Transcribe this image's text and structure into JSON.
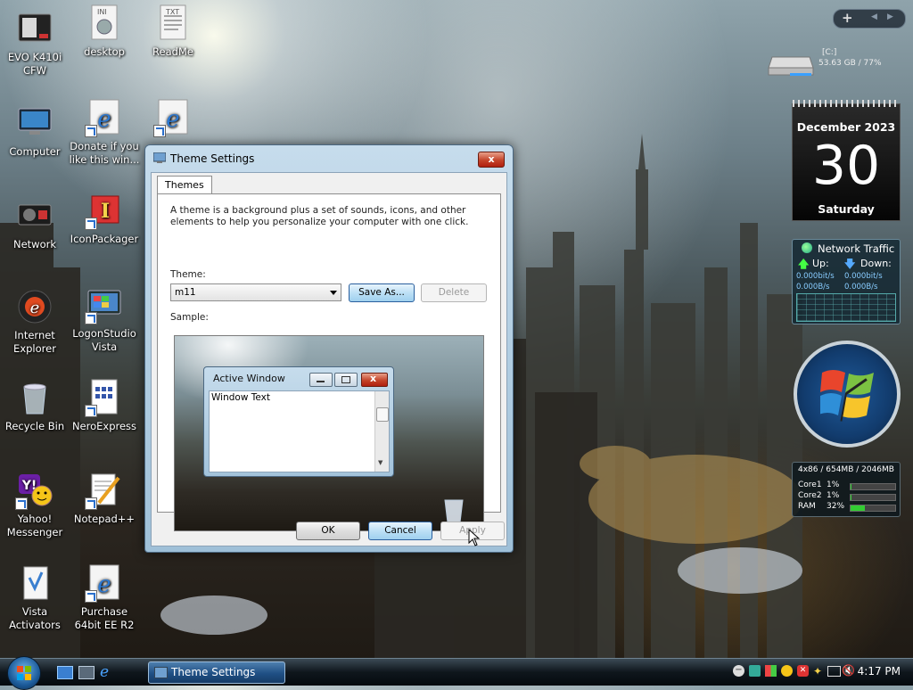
{
  "desktop": {
    "icons": [
      {
        "label": "EVO K410i CFW",
        "icon": "monitor-device-icon"
      },
      {
        "label": "desktop",
        "icon": "ini-file-icon",
        "badge": "INI"
      },
      {
        "label": "ReadMe",
        "icon": "txt-file-icon",
        "badge": "TXT"
      },
      {
        "label": "Computer",
        "icon": "computer-icon"
      },
      {
        "label": "Donate if you like this win...",
        "icon": "internet-explorer-icon"
      },
      {
        "label": "",
        "icon": "internet-explorer-icon"
      },
      {
        "label": "Network",
        "icon": "network-icon"
      },
      {
        "label": "IconPackager",
        "icon": "iconpackager-icon"
      },
      {
        "label": "Internet Explorer",
        "icon": "internet-explorer-icon"
      },
      {
        "label": "LogonStudio Vista",
        "icon": "logonstudio-icon"
      },
      {
        "label": "Recycle Bin",
        "icon": "recycle-bin-icon"
      },
      {
        "label": "NeroExpress",
        "icon": "nero-icon"
      },
      {
        "label": "Yahoo! Messenger",
        "icon": "yahoo-messenger-icon"
      },
      {
        "label": "Notepad++",
        "icon": "notepad-icon"
      },
      {
        "label": "Vista Activators",
        "icon": "folder-icon"
      },
      {
        "label": "Purchase 64bit EE R2",
        "icon": "internet-explorer-icon"
      }
    ]
  },
  "gadgets": {
    "drive": {
      "name": "[C:]",
      "info": "53.63 GB / 77%"
    },
    "calendar": {
      "month": "December 2023",
      "day": "30",
      "weekday": "Saturday"
    },
    "network": {
      "title": "Network Traffic",
      "up_label": "Up:",
      "down_label": "Down:",
      "up_bits": "0.000bit/s",
      "down_bits": "0.000bit/s",
      "up_bytes": "0.000B/s",
      "down_bytes": "0.000B/s"
    },
    "cpu": {
      "header": "4x86 / 654MB / 2046MB",
      "rows": [
        {
          "label": "Core1",
          "value": "1%",
          "pct": 1
        },
        {
          "label": "Core2",
          "value": "1%",
          "pct": 1
        },
        {
          "label": "RAM",
          "value": "32%",
          "pct": 32
        }
      ]
    }
  },
  "window": {
    "title": "Theme Settings",
    "close_label": "x",
    "tab": "Themes",
    "description": "A theme is a background plus a set of sounds, icons, and other elements to help you personalize your computer with one click.",
    "theme_label": "Theme:",
    "theme_value": "m11",
    "save_as": "Save As...",
    "delete": "Delete",
    "sample_label": "Sample:",
    "sample": {
      "title": "Active Window",
      "text": "Window Text"
    },
    "ok": "OK",
    "cancel": "Cancel",
    "apply": "Apply"
  },
  "taskbar": {
    "app": "Theme Settings",
    "time": "4:17 PM"
  }
}
